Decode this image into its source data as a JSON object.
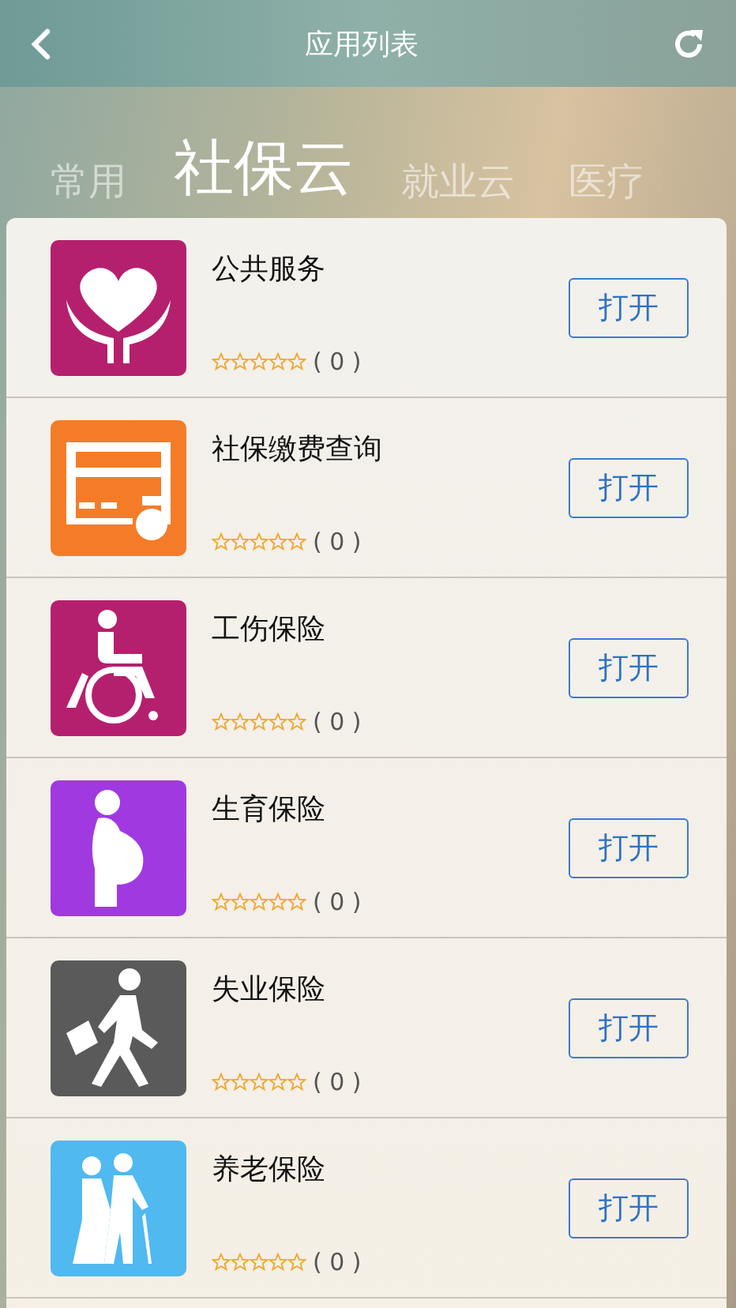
{
  "header": {
    "title": "应用列表"
  },
  "tabs": [
    {
      "label": "常用",
      "selected": false
    },
    {
      "label": "社保云",
      "selected": true
    },
    {
      "label": "就业云",
      "selected": false
    },
    {
      "label": "医疗",
      "selected": false
    }
  ],
  "apps": [
    {
      "name": "公共服务",
      "kind": "heart",
      "color": "#b5206e",
      "stars": 0,
      "count": "( 0 )",
      "button": "打开"
    },
    {
      "name": "社保缴费查询",
      "kind": "card",
      "color": "#f47c28",
      "stars": 0,
      "count": "( 0 )",
      "button": "打开"
    },
    {
      "name": "工伤保险",
      "kind": "wheelchair",
      "color": "#b5206e",
      "stars": 0,
      "count": "( 0 )",
      "button": "打开"
    },
    {
      "name": "生育保险",
      "kind": "pregnant",
      "color": "#a03ae0",
      "stars": 0,
      "count": "( 0 )",
      "button": "打开"
    },
    {
      "name": "失业保险",
      "kind": "walker",
      "color": "#5a5a5a",
      "stars": 0,
      "count": "( 0 )",
      "button": "打开"
    },
    {
      "name": "养老保险",
      "kind": "elderly",
      "color": "#4fb9f0",
      "stars": 0,
      "count": "( 0 )",
      "button": "打开"
    }
  ]
}
